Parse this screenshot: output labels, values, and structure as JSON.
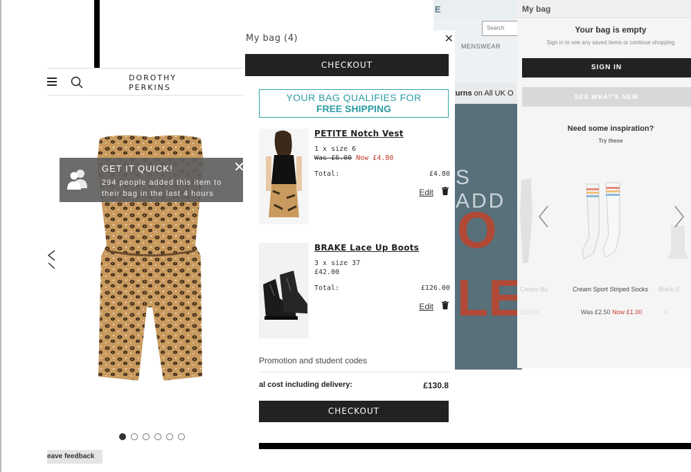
{
  "product_page": {
    "logo_line1": "DOROTHY",
    "logo_line2": "PERKINS",
    "toast": {
      "title": "GET IT QUICK!",
      "body": "294 people added this item to their bag in the last 4 hours",
      "close": "✕"
    },
    "gallery_dots": 6,
    "gallery_active": 0,
    "feedback_label": "eave feedback"
  },
  "cart": {
    "title": "My bag (4)",
    "close": "✕",
    "checkout_label": "CHECKOUT",
    "shipping_line1": "YOUR BAG QUALIFIES FOR",
    "shipping_line2": "FREE SHIPPING",
    "items": [
      {
        "name": "PETITE Notch Vest",
        "size": "1 x size 6",
        "was": "Was £6.00",
        "now": "Now £4.80",
        "total_label": "Total:",
        "total": "£4.80",
        "edit": "Edit"
      },
      {
        "name": "BRAKE Lace Up Boots",
        "size": "3 x size 37",
        "price": "£42.00",
        "total_label": "Total:",
        "total": "£126.00",
        "edit": "Edit"
      }
    ],
    "promo_label": "Promotion and student codes",
    "total_cost_label": "al cost including delivery:",
    "total_cost": "£130.8",
    "checkout2_label": "CHECKOUT"
  },
  "store_background": {
    "logo_fragment": "E",
    "search_placeholder": "Search",
    "nav_item": "MENSWEAR",
    "returns_bold": "eturns",
    "returns_rest": " on All UK O",
    "banner_text": "S ADD",
    "banner_big1": "O",
    "banner_big2": "LE"
  },
  "empty_bag": {
    "title": "My bag",
    "empty_heading": "Your bag is empty",
    "empty_sub": "Sign in to see any saved items or continue shopping",
    "signin_label": "SIGN IN",
    "whats_new_label": "SEE WHAT'S NEW",
    "inspiration": "Need some inspiration?",
    "try_these": "Try these",
    "product_name": "Cream Sport Striped Socks",
    "product_name_left": "Cream Bu",
    "product_name_right": "Black S",
    "was": "Was £2.50",
    "now": "Now £1.00",
    "price_left": "£20.00",
    "price_right": "£"
  },
  "colors": {
    "accent_teal": "#2aa3a8",
    "sale_red": "#c0392b",
    "button_dark": "#222222",
    "store_banner": "#58707a"
  }
}
